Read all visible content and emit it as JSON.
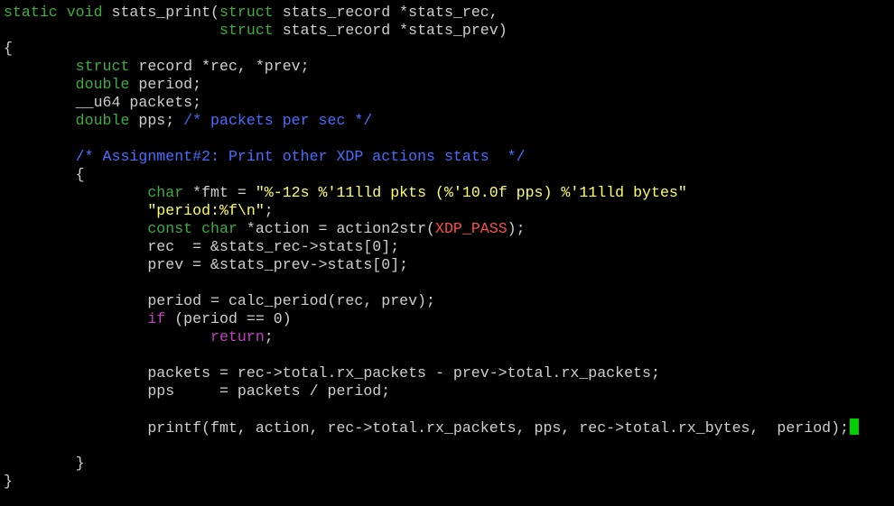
{
  "colors": {
    "background": "#000000",
    "normal": "#cfcfcf",
    "type": "#3fae3f",
    "string": "#ffff66",
    "comment": "#4a6cff",
    "constant": "#ff4b4b",
    "statement": "#c040c0",
    "cursor": "#00d000"
  },
  "code_lines": [
    [
      [
        "type",
        "static void"
      ],
      [
        "normal",
        " stats_print("
      ],
      [
        "type",
        "struct"
      ],
      [
        "normal",
        " stats_record *stats_rec,"
      ]
    ],
    [
      [
        "normal",
        "                        "
      ],
      [
        "type",
        "struct"
      ],
      [
        "normal",
        " stats_record *stats_prev)"
      ]
    ],
    [
      [
        "normal",
        "{"
      ]
    ],
    [
      [
        "normal",
        "        "
      ],
      [
        "type",
        "struct"
      ],
      [
        "normal",
        " record *rec, *prev;"
      ]
    ],
    [
      [
        "normal",
        "        "
      ],
      [
        "type",
        "double"
      ],
      [
        "normal",
        " period;"
      ]
    ],
    [
      [
        "normal",
        "        __u64 packets;"
      ]
    ],
    [
      [
        "normal",
        "        "
      ],
      [
        "type",
        "double"
      ],
      [
        "normal",
        " pps; "
      ],
      [
        "comment",
        "/* packets per sec */"
      ]
    ],
    [],
    [
      [
        "normal",
        "        "
      ],
      [
        "comment",
        "/* Assignment#2: Print other XDP actions stats  */"
      ]
    ],
    [
      [
        "normal",
        "        {"
      ]
    ],
    [
      [
        "normal",
        "                "
      ],
      [
        "type",
        "char"
      ],
      [
        "normal",
        " *fmt = "
      ],
      [
        "string",
        "\"%-12s %'11lld pkts (%'10.0f pps) %'11lld bytes\""
      ]
    ],
    [
      [
        "normal",
        "                "
      ],
      [
        "string",
        "\"period:%f\\n\""
      ],
      [
        "normal",
        ";"
      ]
    ],
    [
      [
        "normal",
        "                "
      ],
      [
        "type",
        "const char"
      ],
      [
        "normal",
        " *action = action2str("
      ],
      [
        "constant",
        "XDP_PASS"
      ],
      [
        "normal",
        ");"
      ]
    ],
    [
      [
        "normal",
        "                rec  = &stats_rec->stats[0];"
      ]
    ],
    [
      [
        "normal",
        "                prev = &stats_prev->stats[0];"
      ]
    ],
    [],
    [
      [
        "normal",
        "                period = calc_period(rec, prev);"
      ]
    ],
    [
      [
        "normal",
        "                "
      ],
      [
        "statement",
        "if"
      ],
      [
        "normal",
        " (period == 0)"
      ]
    ],
    [
      [
        "normal",
        "                       "
      ],
      [
        "statement",
        "return"
      ],
      [
        "normal",
        ";"
      ]
    ],
    [],
    [
      [
        "normal",
        "                packets = rec->total.rx_packets - prev->total.rx_packets;"
      ]
    ],
    [
      [
        "normal",
        "                pps     = packets / period;"
      ]
    ],
    [],
    [
      [
        "normal",
        "                printf(fmt, action, rec->total.rx_packets, pps, rec->total.rx_bytes,  period);"
      ],
      [
        "cursor",
        ""
      ]
    ],
    [],
    [
      [
        "normal",
        "        }"
      ]
    ],
    [
      [
        "normal",
        "}"
      ]
    ]
  ]
}
